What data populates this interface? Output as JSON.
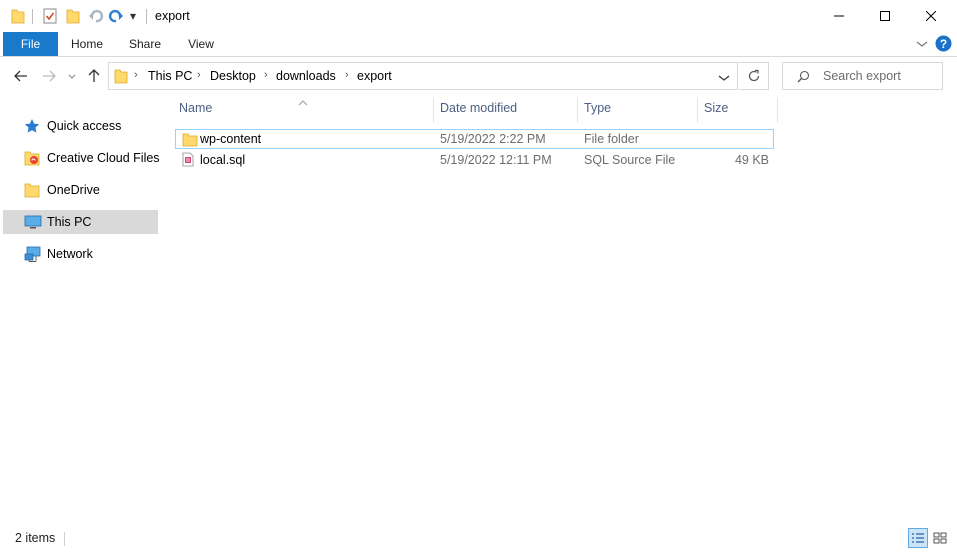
{
  "window": {
    "title": "export",
    "qat_dropdown_glyph": "▾"
  },
  "ribbon": {
    "tabs": [
      "File",
      "Home",
      "Share",
      "View"
    ]
  },
  "address": {
    "breadcrumbs": [
      "This PC",
      "Desktop",
      "downloads",
      "export"
    ]
  },
  "search": {
    "placeholder": "Search export"
  },
  "nav": {
    "items": [
      {
        "label": "Quick access",
        "icon": "star-icon"
      },
      {
        "label": "Creative Cloud Files",
        "icon": "creative-cloud-folder-icon"
      },
      {
        "label": "OneDrive",
        "icon": "folder-icon"
      },
      {
        "label": "This PC",
        "icon": "monitor-icon",
        "selected": true
      },
      {
        "label": "Network",
        "icon": "network-icon"
      }
    ]
  },
  "columns": {
    "name": "Name",
    "date": "Date modified",
    "type": "Type",
    "size": "Size"
  },
  "files": [
    {
      "name": "wp-content",
      "date": "5/19/2022 2:22 PM",
      "type": "File folder",
      "size": "",
      "icon": "folder-icon"
    },
    {
      "name": "local.sql",
      "date": "5/19/2022 12:11 PM",
      "type": "SQL Source File",
      "size": "49 KB",
      "icon": "sql-file-icon"
    }
  ],
  "status": {
    "count": "2 items"
  },
  "colors": {
    "accent": "#1979ca",
    "selection": "#d9d9d9",
    "folder": "#ffd96b",
    "header_text": "#4d6082"
  }
}
